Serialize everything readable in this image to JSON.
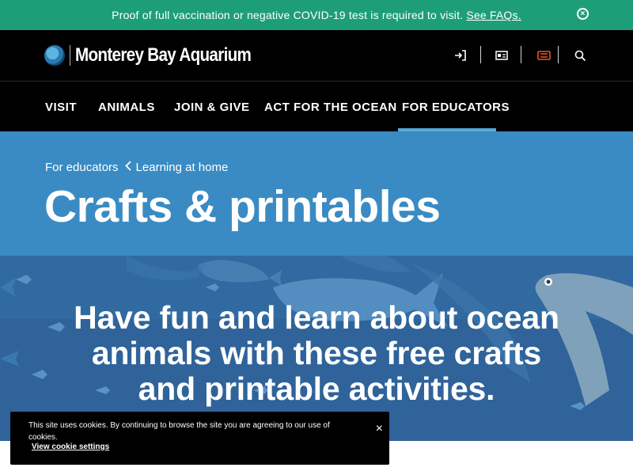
{
  "alert": {
    "message": "Proof of full vaccination or negative COVID-19 test is required to visit.",
    "link": "See FAQs.",
    "close_icon": "close-circle-icon"
  },
  "header": {
    "logo_text": "Monterey Bay Aquarium",
    "utility_icons": [
      "sign-in-icon",
      "membership-card-icon",
      "ticket-icon",
      "search-icon"
    ],
    "accent_color": "#e8532b"
  },
  "nav": {
    "items": [
      {
        "label": "VISIT"
      },
      {
        "label": "ANIMALS"
      },
      {
        "label": "JOIN & GIVE"
      },
      {
        "label": "ACT FOR THE OCEAN"
      },
      {
        "label": "FOR EDUCATORS"
      }
    ],
    "active_index": 4
  },
  "hero": {
    "breadcrumb": [
      "For educators",
      "Learning at home"
    ],
    "title": "Crafts & printables",
    "background_color": "#3a8bc3"
  },
  "intro": {
    "lines": [
      "Have fun and learn about ocean",
      "animals with these free crafts",
      "and printable activities."
    ]
  },
  "cookie": {
    "message": "This site uses cookies. By continuing to browse the site you are agreeing to our use of cookies.",
    "link": "View cookie settings",
    "close": "×"
  }
}
